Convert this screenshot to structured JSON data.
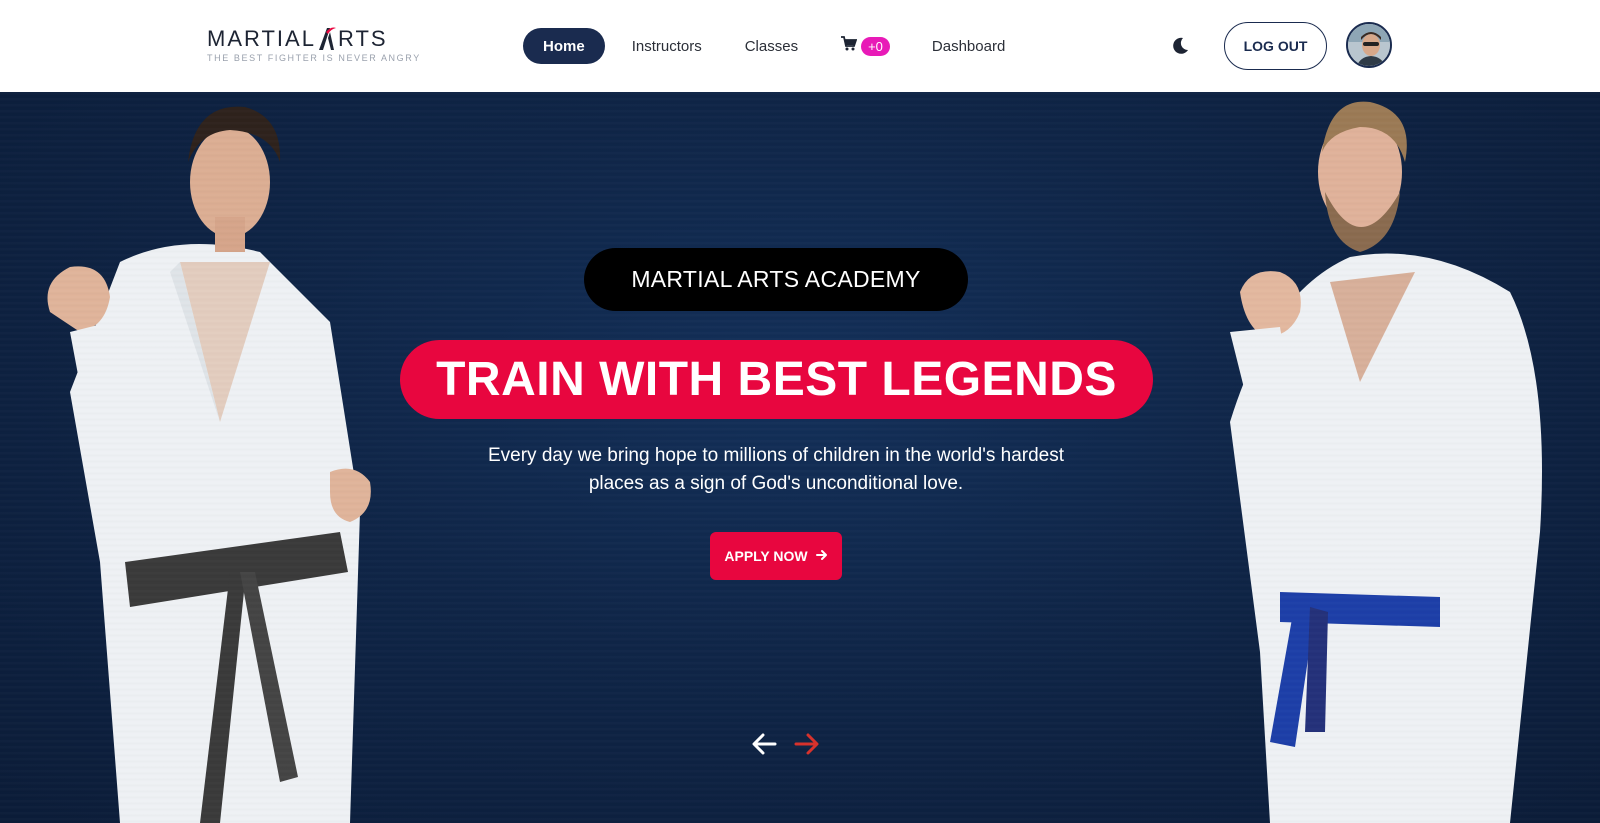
{
  "brand": {
    "logo_main_left": "MARTIAL",
    "logo_main_right": "RTS",
    "tagline": "THE BEST FIGHTER IS NEVER ANGRY"
  },
  "nav": {
    "home": "Home",
    "instructors": "Instructors",
    "classes": "Classes",
    "cart_count": "+0",
    "dashboard": "Dashboard",
    "logout": "LOG OUT"
  },
  "hero": {
    "academy_label": "MARTIAL ARTS ACADEMY",
    "headline": "TRAIN WITH BEST LEGENDS",
    "description": "Every day we bring hope to millions of children in the world's hardest places as a sign of God's unconditional love.",
    "apply_button": "APPLY NOW"
  },
  "colors": {
    "navy": "#1a2b4f",
    "accent_red": "#e8063f",
    "badge_pink": "#e81ab7",
    "hero_bg": "#0f2547"
  },
  "icons": {
    "cart": "cart-icon",
    "theme_toggle": "moon-icon",
    "prev": "arrow-left-icon",
    "next": "arrow-right-icon",
    "apply_arrow": "arrow-right-icon"
  }
}
